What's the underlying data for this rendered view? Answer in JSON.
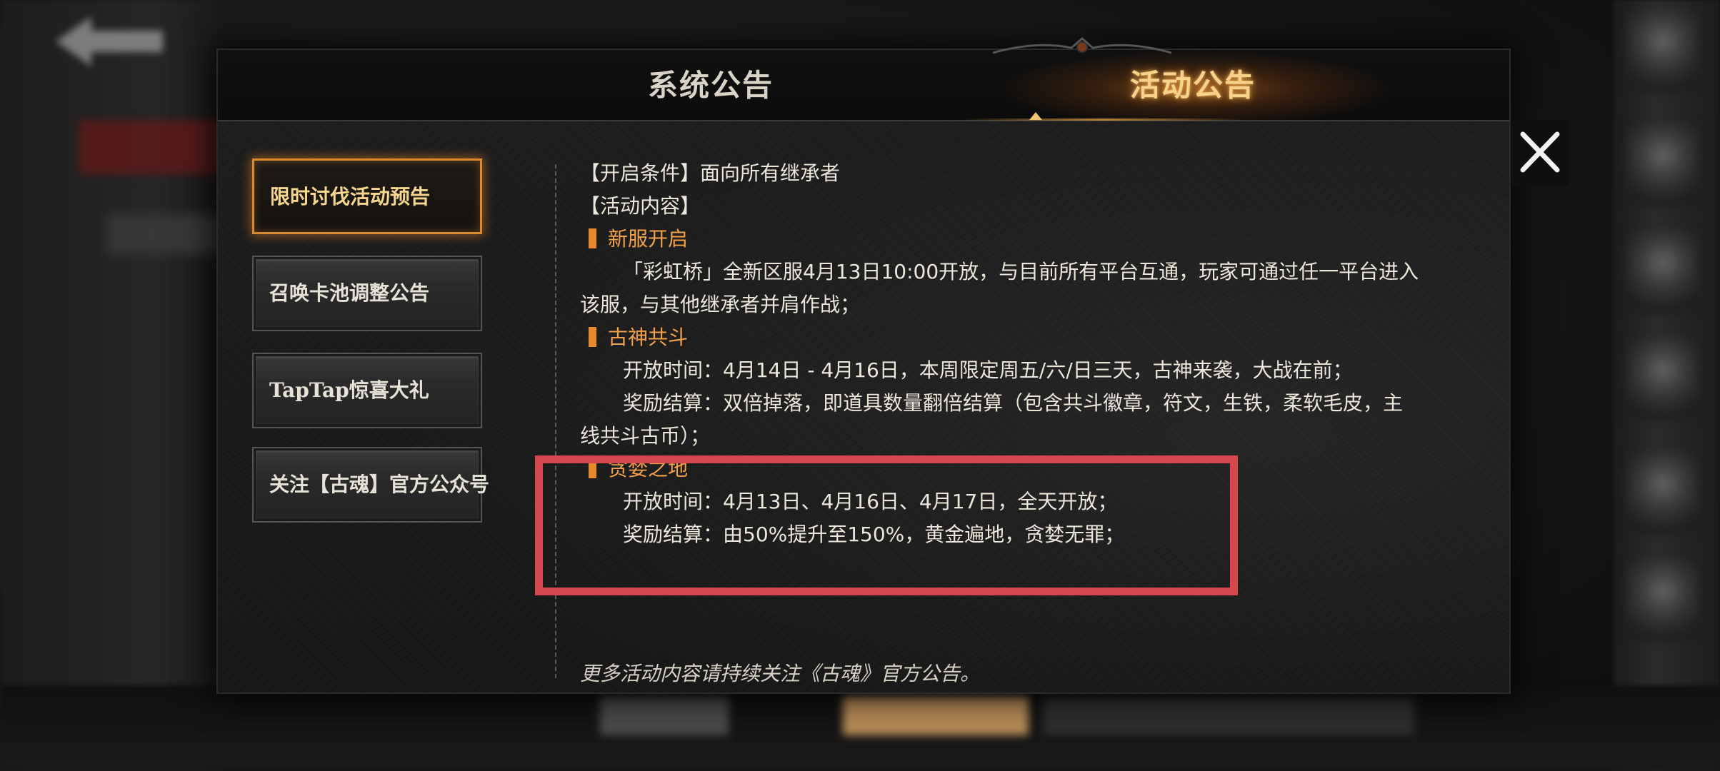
{
  "tabs": {
    "system": "系统公告",
    "activity": "活动公告",
    "active": "activity"
  },
  "sidebar": {
    "items": [
      {
        "label": "限时讨伐活动预告",
        "active": true
      },
      {
        "label": "召唤卡池调整公告",
        "active": false
      },
      {
        "label": "TapTap惊喜大礼",
        "active": false
      },
      {
        "label": "关注【古魂】官方公众号",
        "active": false
      }
    ]
  },
  "content": {
    "condition": "【开启条件】面向所有继承者",
    "section_header": "【活动内容】",
    "sections": [
      {
        "title": "新服开启",
        "lines": [
          "「彩虹桥」全新区服4月13日10:00开放，与目前所有平台互通，玩家可通过任一平台进入",
          "该服，与其他继承者并肩作战；"
        ]
      },
      {
        "title": "古神共斗",
        "lines": [
          "开放时间：4月14日 - 4月16日，本周限定周五/六/日三天，古神来袭，大战在前；",
          "奖励结算：双倍掉落，即道具数量翻倍结算（包含共斗徽章，符文，生铁，柔软毛皮，主",
          "线共斗古币）；"
        ]
      },
      {
        "title": "贪婪之地",
        "lines": [
          "开放时间：4月13日、4月16日、4月17日，全天开放；",
          "奖励结算：由50%提升至150%，黄金遍地，贪婪无罪；"
        ]
      }
    ],
    "footer": "更多活动内容请持续关注《古魂》官方公告。"
  },
  "colors": {
    "accent_orange": "#e88a2c",
    "tab_active": "#f6d28a",
    "highlight_red": "#d4474f"
  },
  "icons": {
    "close": "close-icon",
    "back": "back-arrow-icon"
  }
}
